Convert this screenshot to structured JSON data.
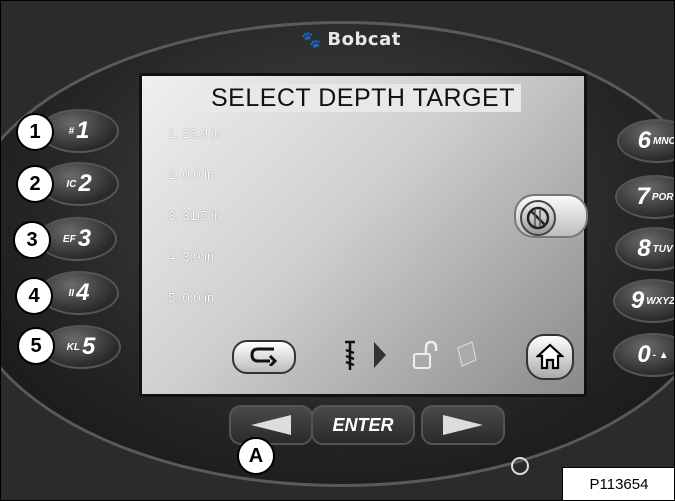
{
  "device": {
    "brand": "Bobcat",
    "logo_icon": "bobcat-head-logo"
  },
  "screen": {
    "title": "SELECT DEPTH TARGET",
    "depth_targets": [
      "1. 23.9 in",
      "2.  0.0 in",
      "3. 31.5 in",
      "4.  3.9 in",
      "5.  0.0 in"
    ],
    "toggle_icon": "no-symbol-icon",
    "soft_bar_icons": [
      "back-arrow-icon",
      "auger-icon",
      "chevron-right-icon",
      "padlock-unlocked-icon",
      "page-icon",
      "home-icon"
    ]
  },
  "left_keys": [
    {
      "label": "1",
      "sub": "#"
    },
    {
      "label": "2",
      "sub": "IC"
    },
    {
      "label": "3",
      "sub": "EF"
    },
    {
      "label": "4",
      "sub": "II"
    },
    {
      "label": "5",
      "sub": "KL"
    }
  ],
  "right_keys": [
    {
      "label": "6",
      "sub": "MNO"
    },
    {
      "label": "7",
      "sub": "POR"
    },
    {
      "label": "8",
      "sub": "TUV"
    },
    {
      "label": "9",
      "sub": "WXYZ"
    },
    {
      "label": "0",
      "sub": "- ▲"
    }
  ],
  "nav": {
    "enter_label": "ENTER"
  },
  "callouts": [
    "1",
    "2",
    "3",
    "4",
    "5",
    "A"
  ],
  "figure_ref": "P113654"
}
